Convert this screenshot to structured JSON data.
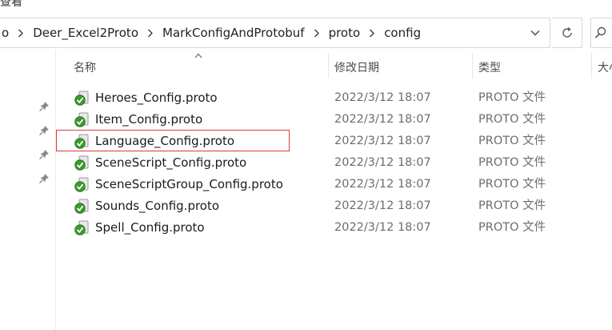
{
  "window": {
    "title_fragment": "查看"
  },
  "address_bar": {
    "crumbs": [
      "o",
      "Deer_Excel2Proto",
      "MarkConfigAndProtobuf",
      "proto",
      "config"
    ]
  },
  "columns": {
    "name": "名称",
    "modified": "修改日期",
    "type": "类型",
    "size": "大小"
  },
  "files": [
    {
      "name": "Heroes_Config.proto",
      "modified": "2022/3/12 18:07",
      "type": "PROTO 文件"
    },
    {
      "name": "Item_Config.proto",
      "modified": "2022/3/12 18:07",
      "type": "PROTO 文件"
    },
    {
      "name": "Language_Config.proto",
      "modified": "2022/3/12 18:07",
      "type": "PROTO 文件"
    },
    {
      "name": "SceneScript_Config.proto",
      "modified": "2022/3/12 18:07",
      "type": "PROTO 文件"
    },
    {
      "name": "SceneScriptGroup_Config.proto",
      "modified": "2022/3/12 18:07",
      "type": "PROTO 文件"
    },
    {
      "name": "Sounds_Config.proto",
      "modified": "2022/3/12 18:07",
      "type": "PROTO 文件"
    },
    {
      "name": "Spell_Config.proto",
      "modified": "2022/3/12 18:07",
      "type": "PROTO 文件"
    }
  ],
  "highlight_color": "#d93c3c"
}
